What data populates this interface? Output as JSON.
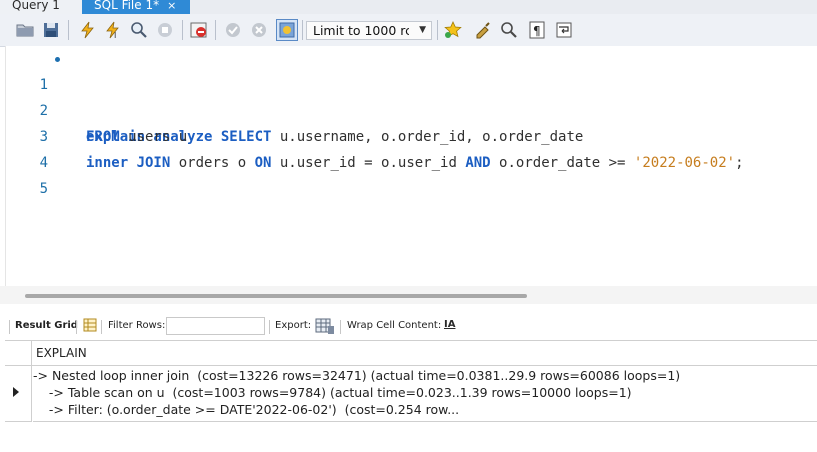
{
  "tabs": [
    {
      "label": "Query 1"
    },
    {
      "label": "SQL File 1*",
      "close": "×"
    }
  ],
  "toolbar": {
    "limit_value": "Limit to 1000 rc"
  },
  "editor": {
    "line_numbers": [
      "1",
      "2",
      "3",
      "4",
      "5"
    ],
    "lines": [
      [
        {
          "t": "explain analyze SELECT",
          "c": "kw"
        },
        {
          "t": " u.username, o.order_id, o.order_date",
          "c": "id"
        }
      ],
      [
        {
          "t": "FROM",
          "c": "kw"
        },
        {
          "t": " users u",
          "c": "id"
        }
      ],
      [
        {
          "t": "inner JOIN",
          "c": "kw"
        },
        {
          "t": " orders o ",
          "c": "id"
        },
        {
          "t": "ON",
          "c": "kw"
        },
        {
          "t": " u.user_id = o.user_id ",
          "c": "id"
        },
        {
          "t": "AND",
          "c": "kw"
        },
        {
          "t": " o.order_date >= ",
          "c": "id"
        },
        {
          "t": "'2022-06-02'",
          "c": "str"
        },
        {
          "t": ";",
          "c": "id"
        }
      ],
      [],
      []
    ]
  },
  "result_toolbar": {
    "result_grid": "Result Grid",
    "filter_rows": "Filter Rows:",
    "export": "Export:",
    "wrap": "Wrap Cell Content:",
    "wrap_icon": "IA"
  },
  "grid": {
    "column": "EXPLAIN",
    "row_lines": [
      "-> Nested loop inner join  (cost=13226 rows=32471) (actual time=0.0381..29.9 rows=60086 loops=1)",
      "    -> Table scan on u  (cost=1003 rows=9784) (actual time=0.023..1.39 rows=10000 loops=1)",
      "    -> Filter: (o.order_date >= DATE'2022-06-02')  (cost=0.254 row..."
    ]
  }
}
